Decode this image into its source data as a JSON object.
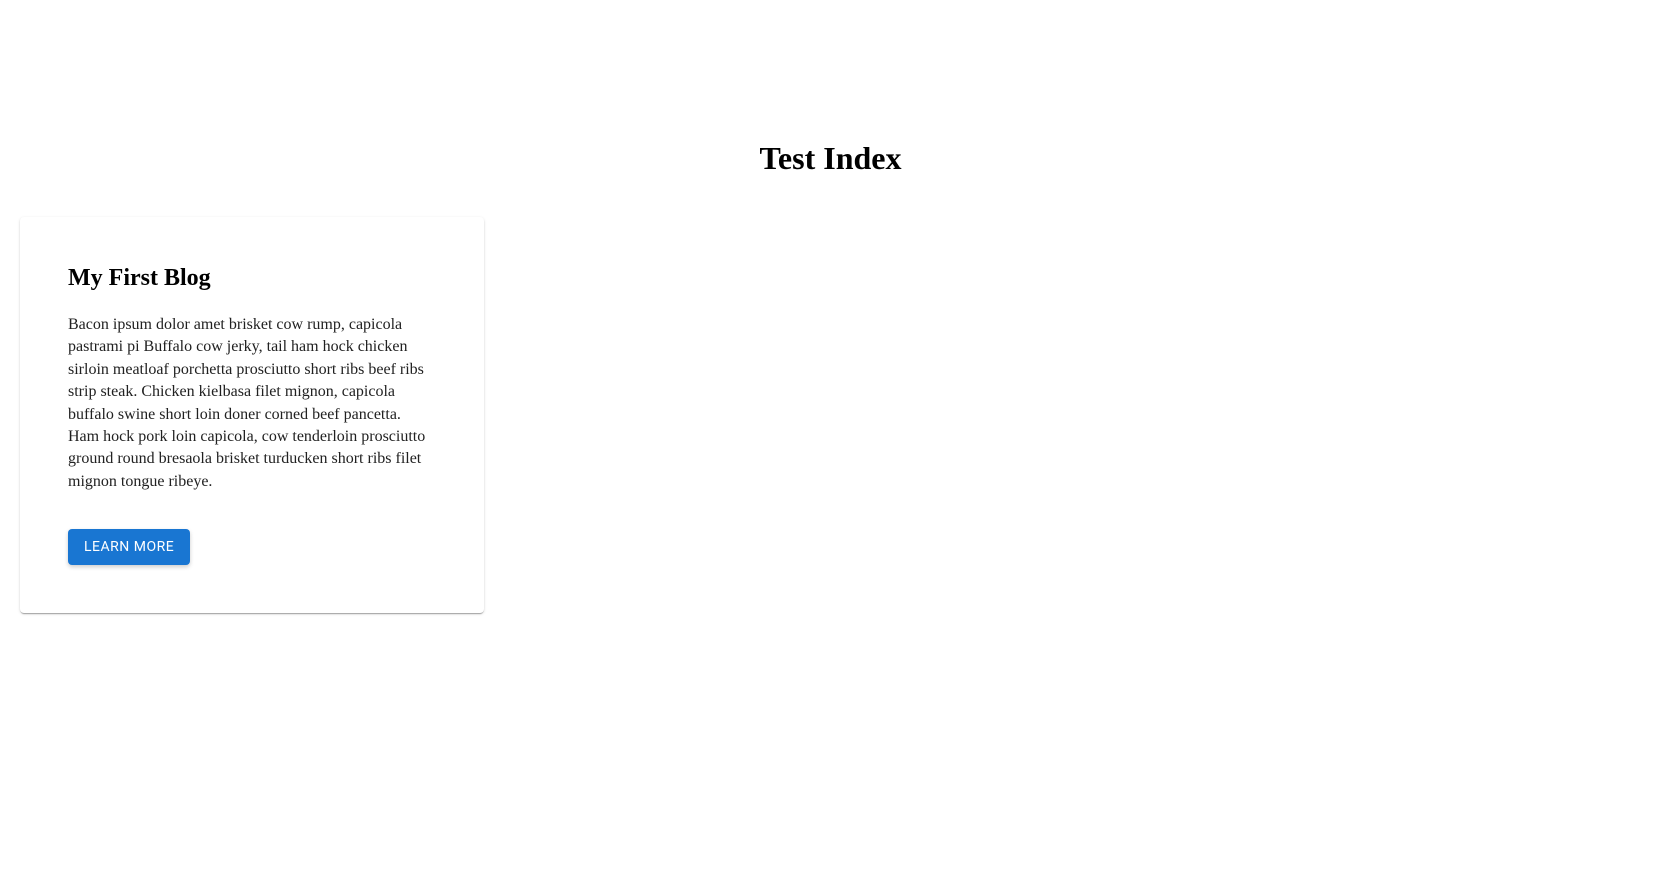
{
  "page": {
    "title": "Test Index"
  },
  "card": {
    "title": "My First Blog",
    "description": "Bacon ipsum dolor amet brisket cow rump, capicola pastrami pi Buffalo cow jerky, tail ham hock chicken sirloin meatloaf porchetta prosciutto short ribs beef ribs strip steak. Chicken kielbasa filet mignon, capicola buffalo swine short loin doner corned beef pancetta. Ham hock pork loin capicola, cow tenderloin prosciutto ground round bresaola brisket turducken short ribs filet mignon tongue ribeye.",
    "button_label": "LEARN MORE"
  }
}
